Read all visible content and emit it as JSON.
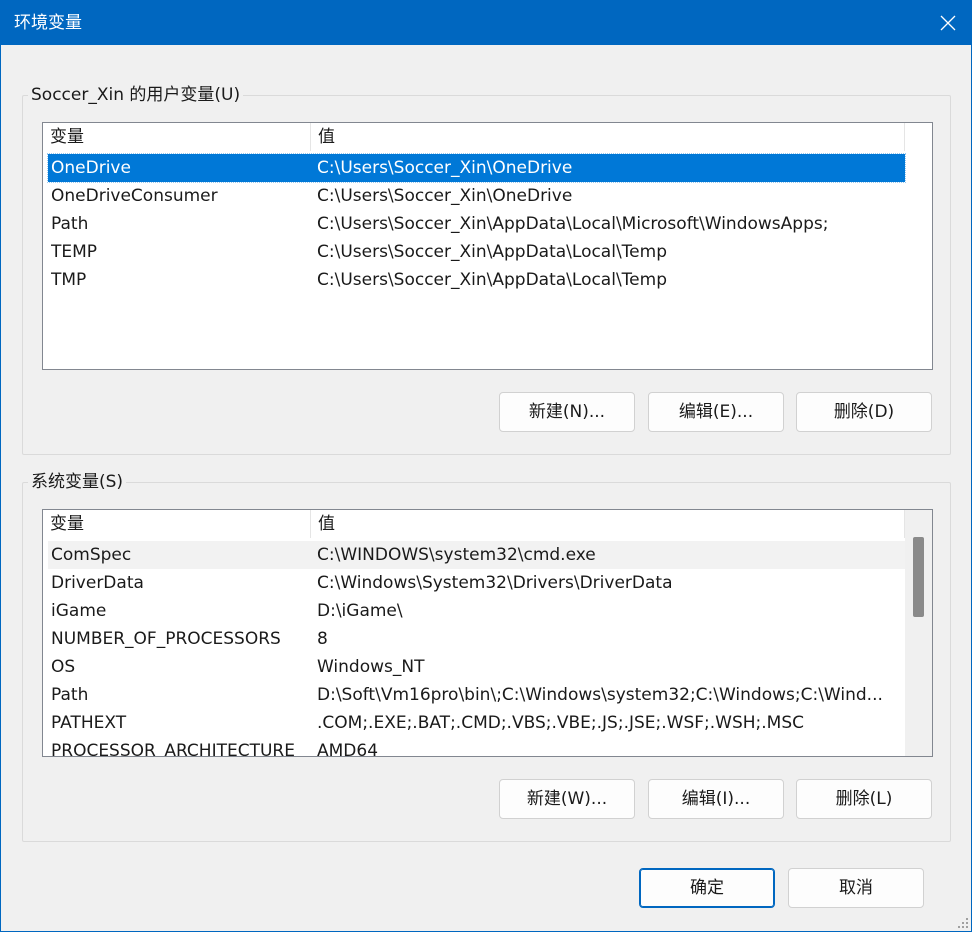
{
  "window": {
    "title": "环境变量"
  },
  "user_section": {
    "label": "Soccer_Xin 的用户变量(U)",
    "columns": [
      "变量",
      "值"
    ],
    "rows": [
      {
        "name": "OneDrive",
        "value": "C:\\Users\\Soccer_Xin\\OneDrive"
      },
      {
        "name": "OneDriveConsumer",
        "value": "C:\\Users\\Soccer_Xin\\OneDrive"
      },
      {
        "name": "Path",
        "value": "C:\\Users\\Soccer_Xin\\AppData\\Local\\Microsoft\\WindowsApps;"
      },
      {
        "name": "TEMP",
        "value": "C:\\Users\\Soccer_Xin\\AppData\\Local\\Temp"
      },
      {
        "name": "TMP",
        "value": "C:\\Users\\Soccer_Xin\\AppData\\Local\\Temp"
      }
    ],
    "buttons": {
      "new": "新建(N)...",
      "edit": "编辑(E)...",
      "delete": "删除(D)"
    }
  },
  "system_section": {
    "label": "系统变量(S)",
    "columns": [
      "变量",
      "值"
    ],
    "rows": [
      {
        "name": "ComSpec",
        "value": "C:\\WINDOWS\\system32\\cmd.exe"
      },
      {
        "name": "DriverData",
        "value": "C:\\Windows\\System32\\Drivers\\DriverData"
      },
      {
        "name": "iGame",
        "value": "D:\\iGame\\"
      },
      {
        "name": "NUMBER_OF_PROCESSORS",
        "value": "8"
      },
      {
        "name": "OS",
        "value": "Windows_NT"
      },
      {
        "name": "Path",
        "value": "D:\\Soft\\Vm16pro\\bin\\;C:\\Windows\\system32;C:\\Windows;C:\\Wind..."
      },
      {
        "name": "PATHEXT",
        "value": ".COM;.EXE;.BAT;.CMD;.VBS;.VBE;.JS;.JSE;.WSF;.WSH;.MSC"
      },
      {
        "name": "PROCESSOR_ARCHITECTURE",
        "value": "AMD64"
      }
    ],
    "buttons": {
      "new": "新建(W)...",
      "edit": "编辑(I)...",
      "delete": "删除(L)"
    }
  },
  "footer": {
    "ok": "确定",
    "cancel": "取消"
  },
  "colors": {
    "accent": "#0067c0",
    "selection": "#0078d7"
  }
}
